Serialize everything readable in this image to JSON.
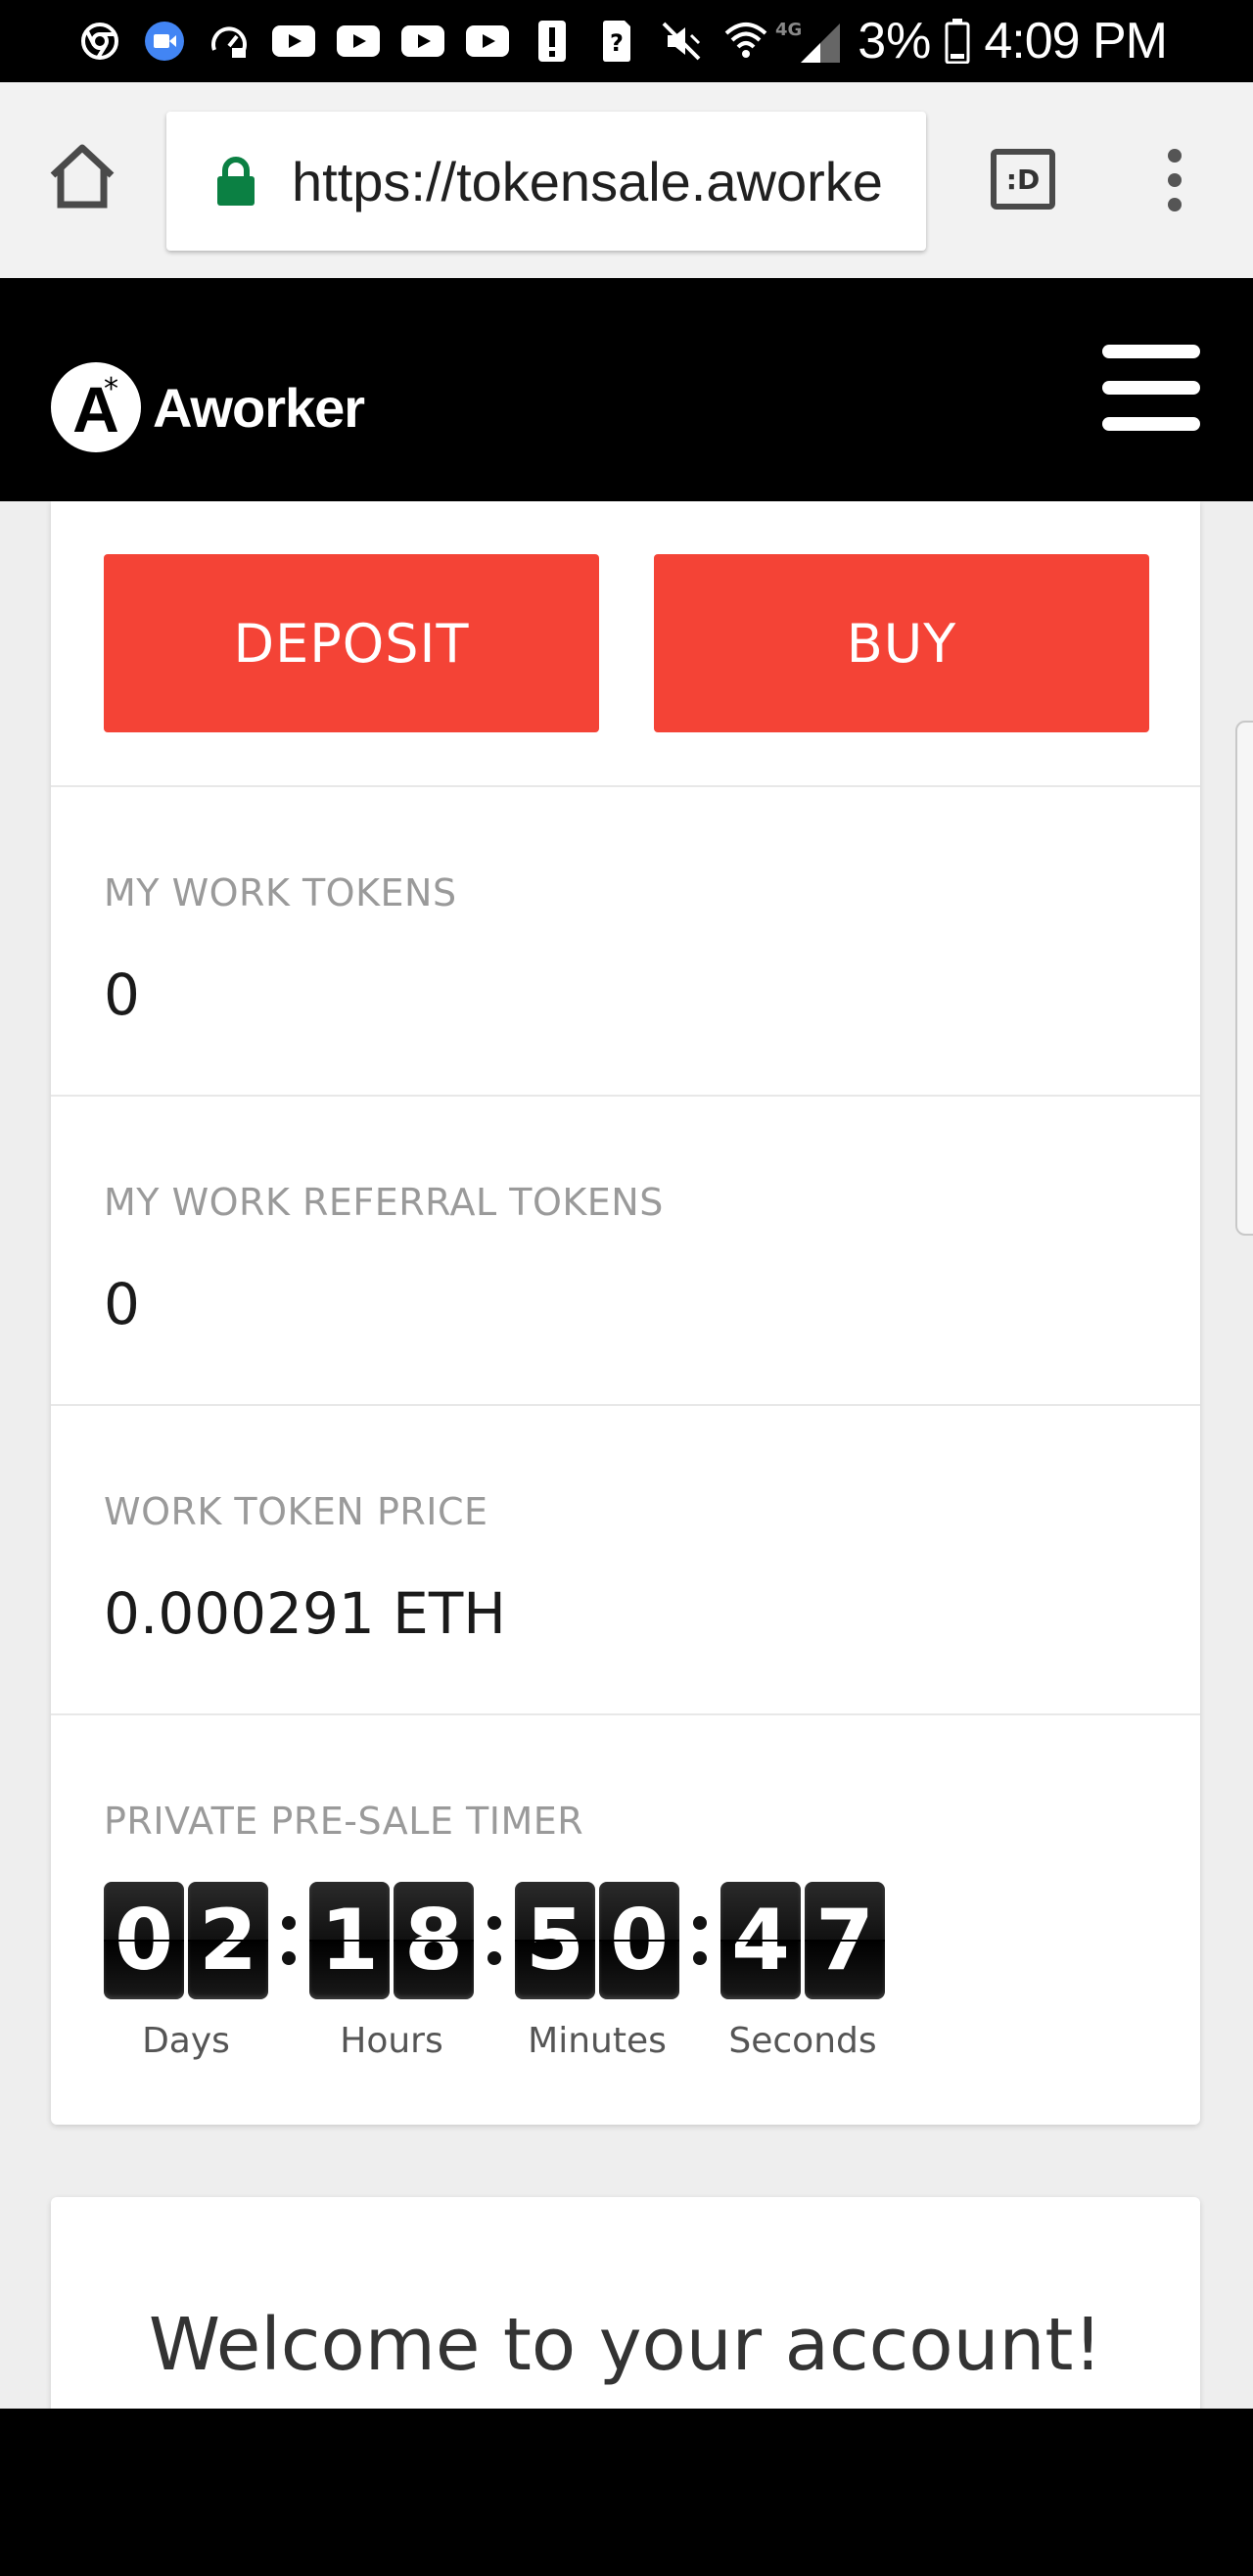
{
  "status_bar": {
    "battery_percent": "3%",
    "time": "4:09 PM",
    "network": "4G",
    "icons": [
      "chrome-icon",
      "duo-icon",
      "speedometer-icon",
      "youtube-icon",
      "youtube-icon",
      "youtube-icon",
      "youtube-icon",
      "alert-icon",
      "unknown-sim-icon",
      "mute-vibrate-icon",
      "wifi-icon",
      "signal-icon",
      "battery-icon"
    ]
  },
  "browser": {
    "url": "https://tokensale.aworke",
    "tabs_label": ":D"
  },
  "site": {
    "brand": "Aworker",
    "logo_letter": "A",
    "logo_star": "*"
  },
  "actions": {
    "deposit_label": "DEPOSIT",
    "buy_label": "BUY"
  },
  "stats": [
    {
      "label": "MY WORK TOKENS",
      "value": "0"
    },
    {
      "label": "MY WORK REFERRAL TOKENS",
      "value": "0"
    },
    {
      "label": "WORK TOKEN PRICE",
      "value": "0.000291 ETH"
    }
  ],
  "timer": {
    "label": "PRIVATE PRE-SALE TIMER",
    "units": [
      {
        "digits": [
          "0",
          "2"
        ],
        "label": "Days"
      },
      {
        "digits": [
          "1",
          "8"
        ],
        "label": "Hours"
      },
      {
        "digits": [
          "5",
          "0"
        ],
        "label": "Minutes"
      },
      {
        "digits": [
          "4",
          "7"
        ],
        "label": "Seconds"
      }
    ]
  },
  "welcome": {
    "title": "Welcome to your account!"
  },
  "colors": {
    "accent": "#f44336",
    "header_bg": "#000000",
    "page_bg": "#eeeeee"
  }
}
